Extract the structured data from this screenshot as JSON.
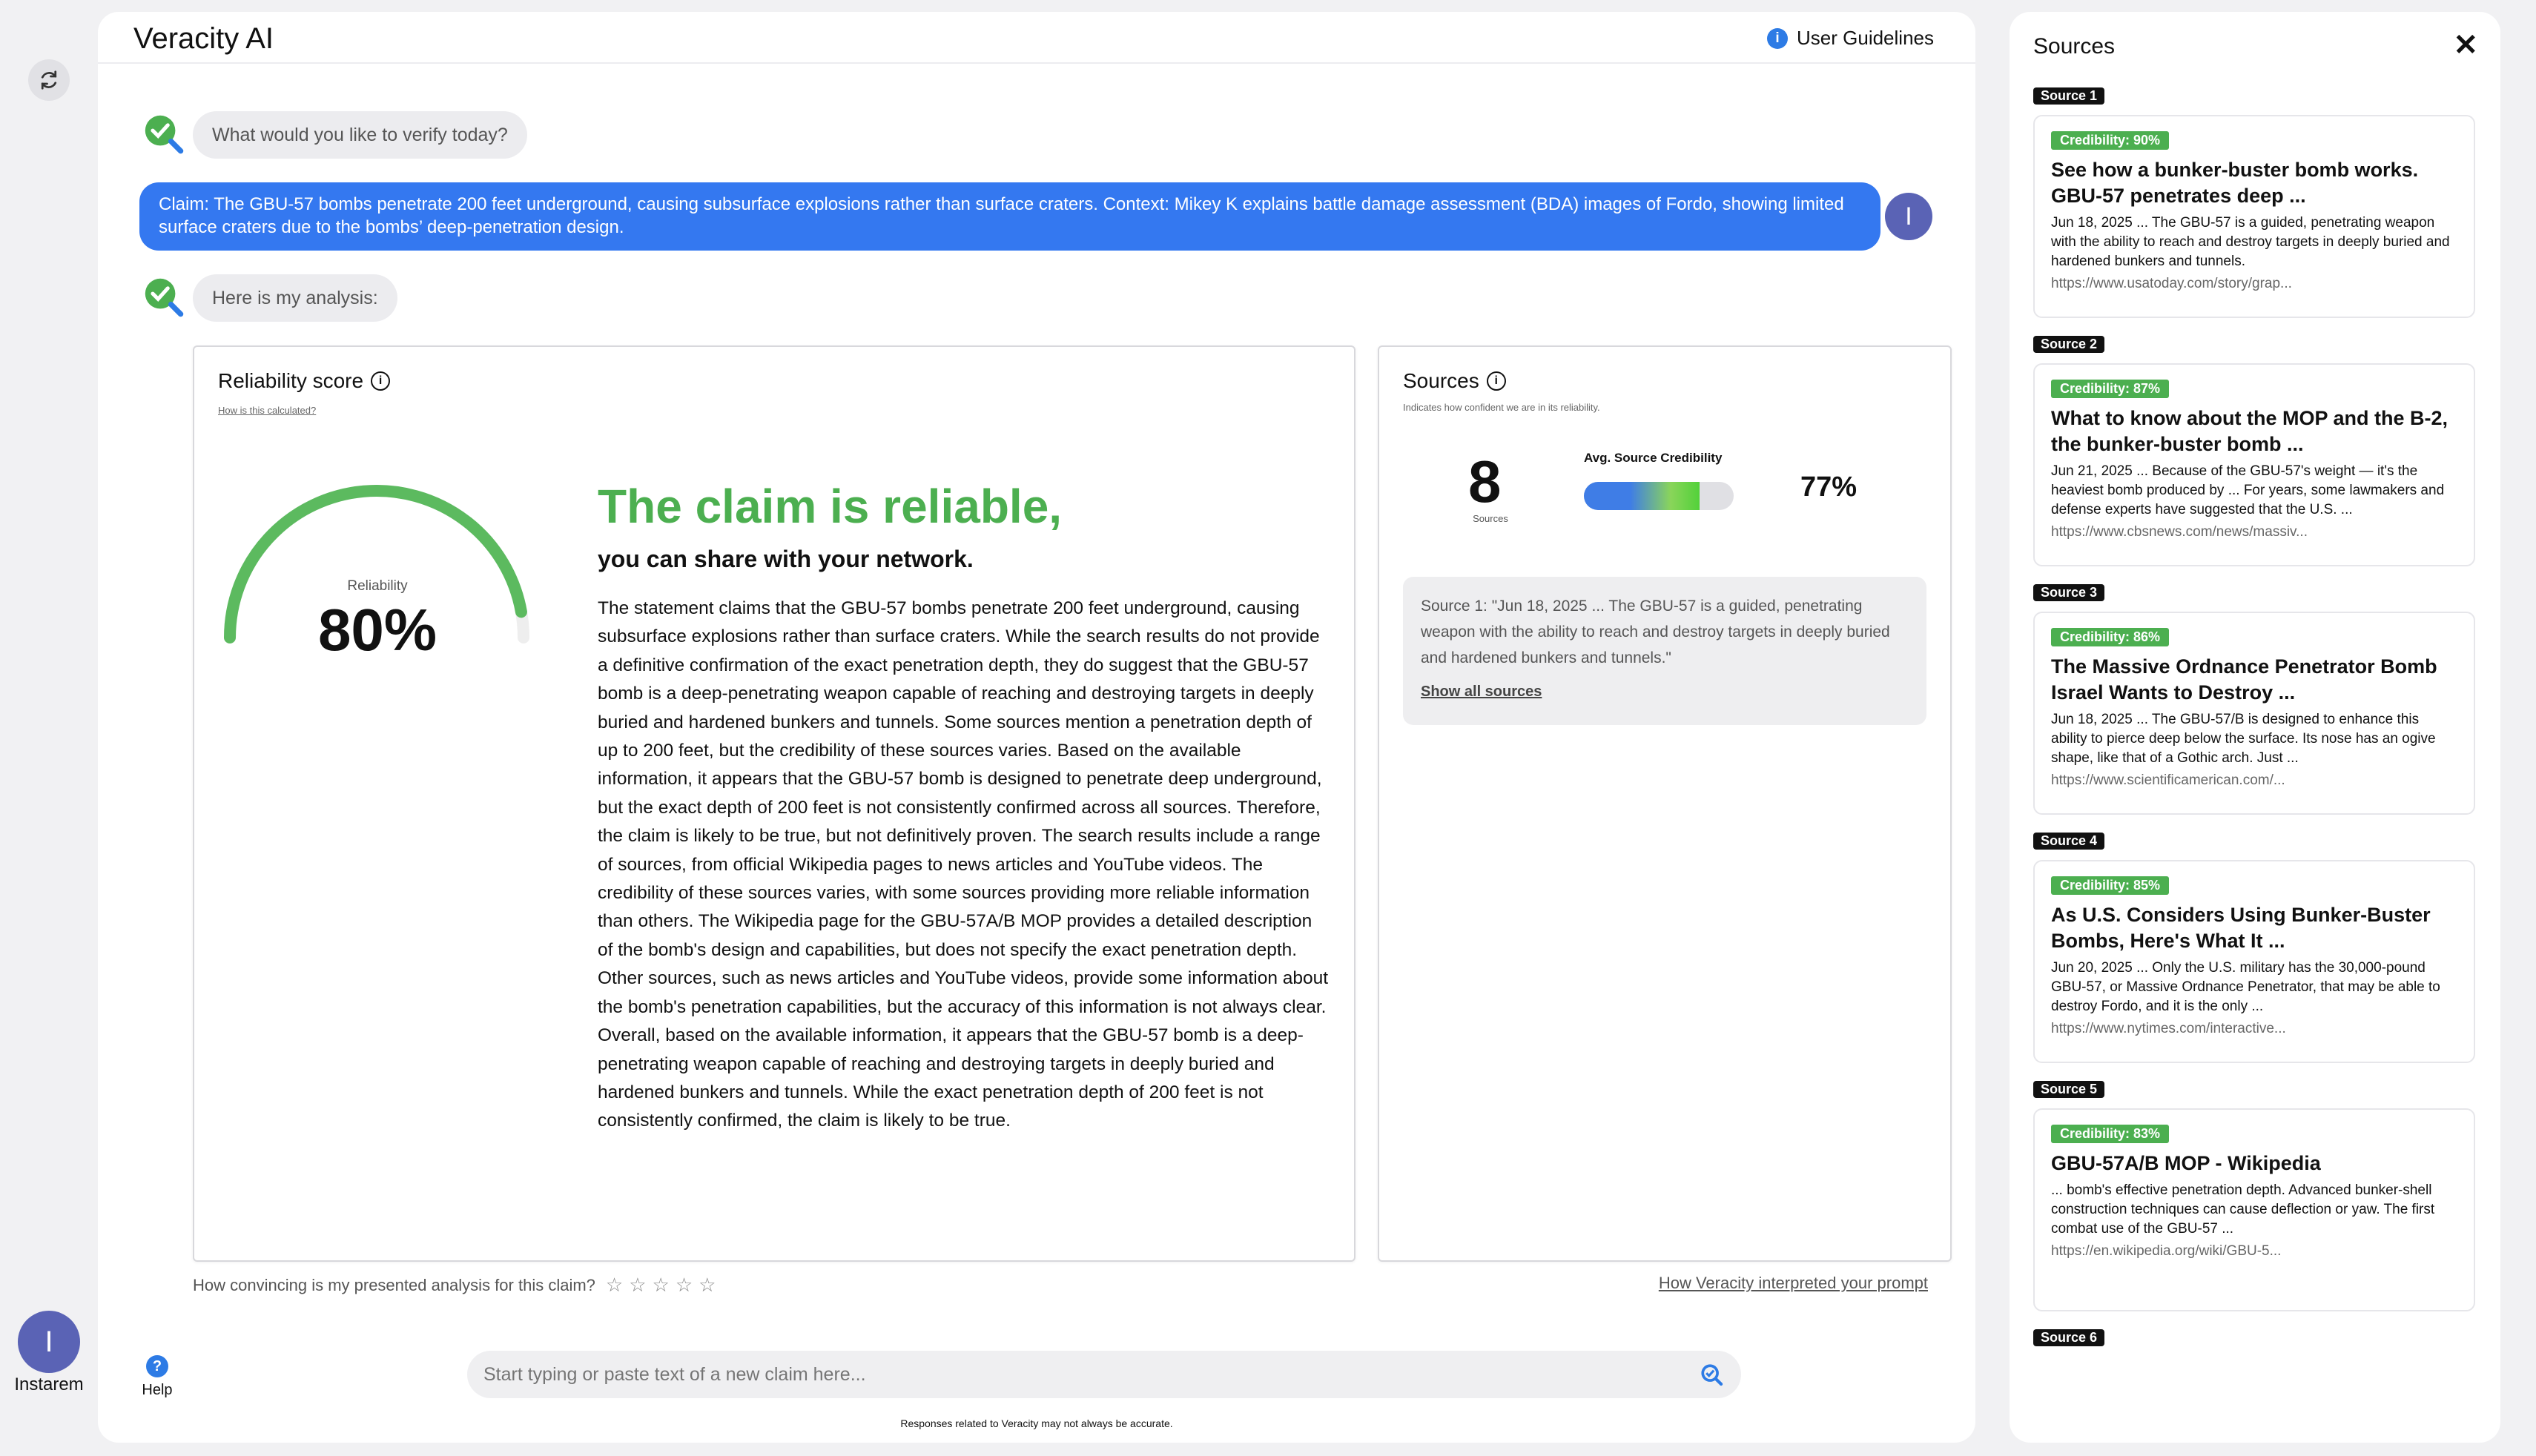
{
  "app": {
    "title": "Veracity AI",
    "guidelines_label": "User Guidelines"
  },
  "user": {
    "initial": "I",
    "name": "Instarem"
  },
  "chat": {
    "prompt": "What would you like to verify today?",
    "claim_message": "Claim: The GBU-57 bombs penetrate 200 feet underground, causing subsurface explosions rather than surface craters. Context: Mikey K explains battle damage assessment (BDA) images of Fordo, showing limited surface craters due to the bombs’ deep-penetration design.",
    "analysis_intro": "Here is my analysis:"
  },
  "reliability": {
    "title": "Reliability score",
    "how_link": "How is this calculated?",
    "gauge_label": "Reliability",
    "score": 0.8,
    "score_text": "80%",
    "verdict": "The claim is reliable,",
    "verdict_sub": "you can share with your network.",
    "analysis": "The statement claims that the GBU-57 bombs penetrate 200 feet underground, causing subsurface explosions rather than surface craters. While the search results do not provide a definitive confirmation of the exact penetration depth, they do suggest that the GBU-57 bomb is a deep-penetrating weapon capable of reaching and destroying targets in deeply buried and hardened bunkers and tunnels. Some sources mention a penetration depth of up to 200 feet, but the credibility of these sources varies. Based on the available information, it appears that the GBU-57 bomb is designed to penetrate deep underground, but the exact depth of 200 feet is not consistently confirmed across all sources. Therefore, the claim is likely to be true, but not definitively proven. The search results include a range of sources, from official Wikipedia pages to news articles and YouTube videos. The credibility of these sources varies, with some sources providing more reliable information than others. The Wikipedia page for the GBU-57A/B MOP provides a detailed description of the bomb's design and capabilities, but does not specify the exact penetration depth. Other sources, such as news articles and YouTube videos, provide some information about the bomb's penetration capabilities, but the accuracy of this information is not always clear. Overall, based on the available information, it appears that the GBU-57 bomb is a deep-penetrating weapon capable of reaching and destroying targets in deeply buried and hardened bunkers and tunnels. While the exact penetration depth of 200 feet is not consistently confirmed, the claim is likely to be true."
  },
  "sources_card": {
    "title": "Sources",
    "note": "Indicates how confident we are in its reliability.",
    "count": "8",
    "count_label": "Sources",
    "avg_label": "Avg. Source Credibility",
    "avg_value": 0.77,
    "avg_text": "77%",
    "snippet": "Source 1: \"Jun 18, 2025 ... The GBU-57 is a guided, penetrating weapon with the ability to reach and destroy targets in deeply buried and hardened bunkers and tunnels.\"",
    "show_all": "Show all sources"
  },
  "feedback": {
    "question": "How convincing is my presented analysis for this claim?",
    "stars": "☆☆☆☆☆",
    "interp_link": "How Veracity interpreted your prompt"
  },
  "help_label": "Help",
  "input": {
    "placeholder": "Start typing or paste text of a new claim here..."
  },
  "disclaimer": "Responses related to Veracity may not always be accurate.",
  "sidebar": {
    "title": "Sources",
    "close": "✕",
    "sources": [
      {
        "tag": "Source 1",
        "credibility": "Credibility: 90%",
        "title": "See how a bunker-buster bomb works. GBU-57 penetrates deep ...",
        "snippet": "Jun 18, 2025 ... The GBU-57 is a guided, penetrating weapon with the ability to reach and destroy targets in deeply buried and hardened bunkers and tunnels.",
        "url": "https://www.usatoday.com/story/grap..."
      },
      {
        "tag": "Source 2",
        "credibility": "Credibility: 87%",
        "title": "What to know about the MOP and the B-2, the bunker-buster bomb ...",
        "snippet": "Jun 21, 2025 ... Because of the GBU-57's weight — it's the heaviest bomb produced by ... For years, some lawmakers and defense experts have suggested that the U.S. ...",
        "url": "https://www.cbsnews.com/news/massiv..."
      },
      {
        "tag": "Source 3",
        "credibility": "Credibility: 86%",
        "title": "The Massive Ordnance Penetrator Bomb Israel Wants to Destroy ...",
        "snippet": "Jun 18, 2025 ... The GBU-57/B is designed to enhance this ability to pierce deep below the surface. Its nose has an ogive shape, like that of a Gothic arch. Just ...",
        "url": "https://www.scientificamerican.com/..."
      },
      {
        "tag": "Source 4",
        "credibility": "Credibility: 85%",
        "title": "As U.S. Considers Using Bunker-Buster Bombs, Here's What It ...",
        "snippet": "Jun 20, 2025 ... Only the U.S. military has the 30,000-pound GBU-57, or Massive Ordnance Penetrator, that may be able to destroy Fordo, and it is the only ...",
        "url": "https://www.nytimes.com/interactive..."
      },
      {
        "tag": "Source 5",
        "credibility": "Credibility: 83%",
        "title": "GBU-57A/B MOP - Wikipedia",
        "snippet": "... bomb's effective penetration depth. Advanced bunker-shell construction techniques can cause deflection or yaw. The first combat use of the GBU-57 ...",
        "url": "https://en.wikipedia.org/wiki/GBU-5..."
      },
      {
        "tag": "Source 6"
      }
    ]
  },
  "colors": {
    "accent_blue": "#3478f0",
    "reliable_green": "#4caf50",
    "avatar": "#5a63b5"
  }
}
